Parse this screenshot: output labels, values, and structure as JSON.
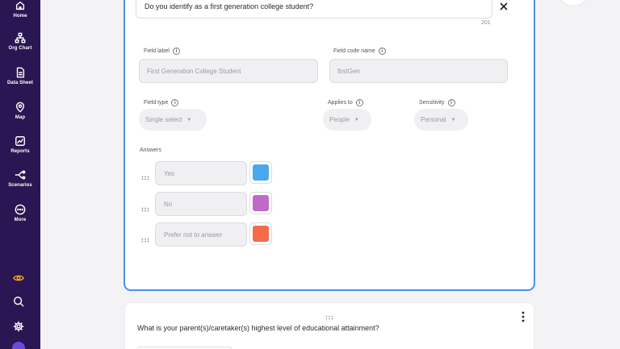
{
  "sidebar": {
    "items": [
      {
        "label": "Home",
        "icon": "home-icon"
      },
      {
        "label": "Org Chart",
        "icon": "org-chart-icon"
      },
      {
        "label": "Data Sheet",
        "icon": "data-sheet-icon"
      },
      {
        "label": "Map",
        "icon": "map-pin-icon"
      },
      {
        "label": "Reports",
        "icon": "reports-icon"
      },
      {
        "label": "Scenarios",
        "icon": "scenarios-icon"
      },
      {
        "label": "More",
        "icon": "more-icon"
      }
    ],
    "tools": [
      {
        "icon": "eye-icon",
        "color": "#f0a020"
      },
      {
        "icon": "search-icon",
        "color": "#ffffff"
      },
      {
        "icon": "gear-icon",
        "color": "#ffffff"
      }
    ]
  },
  "question": {
    "text": "Do you identify as a first generation college student?",
    "char_count": "201"
  },
  "fields": {
    "label_title": "Field label",
    "label_value": "First Generation College Student",
    "code_title": "Field code name",
    "code_value": "firstGen",
    "type_title": "Field type",
    "type_value": "Single select",
    "applies_title": "Applies to",
    "applies_value": "People",
    "sensitivity_title": "Sensitivity",
    "sensitivity_value": "Personal"
  },
  "answers": {
    "title": "Answers",
    "items": [
      {
        "label": "Yes",
        "color": "#4aa8ec"
      },
      {
        "label": "No",
        "color": "#c06ac8"
      },
      {
        "label": "Prefer not to answer",
        "color": "#f66a4a"
      }
    ]
  },
  "next_question": {
    "text": "What is your parent(s)/caretaker(s) highest level of educational attainment?"
  },
  "colors": {
    "sidebar_bg": "#2a1652",
    "active_border": "#4f8fe8"
  }
}
